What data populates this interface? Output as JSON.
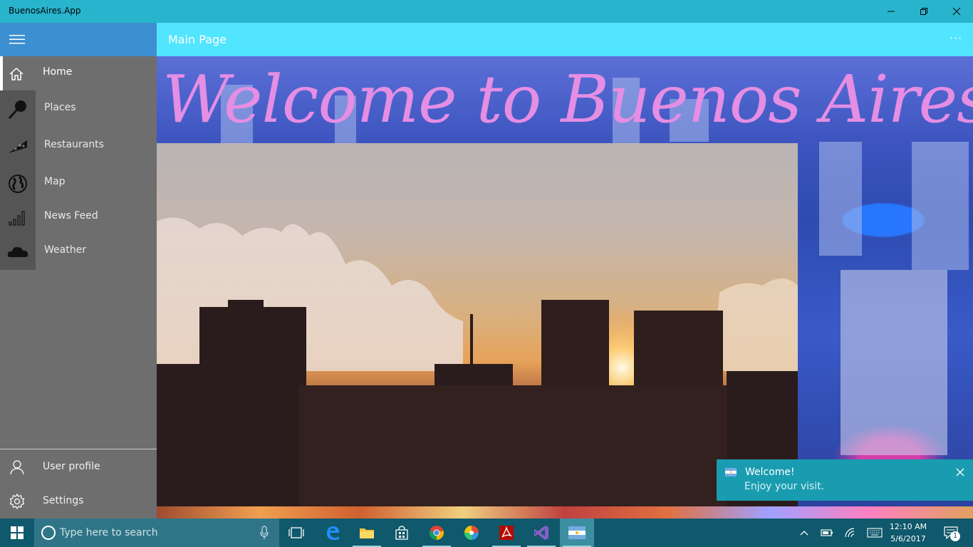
{
  "window": {
    "title": "BuenosAires.App",
    "title_bar_color": "#28b4cc"
  },
  "sidebar": {
    "header_color": "#3c8fd0",
    "items": [
      {
        "label": "Home",
        "icon": "home-icon",
        "active": true
      },
      {
        "label": "Places",
        "icon": "map-pin-icon"
      },
      {
        "label": "Restaurants",
        "icon": "pizza-icon"
      },
      {
        "label": "Map",
        "icon": "globe-icon"
      },
      {
        "label": "News Feed",
        "icon": "signal-bars-icon"
      },
      {
        "label": "Weather",
        "icon": "cloud-icon"
      }
    ],
    "bottom_items": [
      {
        "label": "User profile",
        "icon": "user-icon"
      },
      {
        "label": "Settings",
        "icon": "gear-icon"
      }
    ]
  },
  "page": {
    "title": "Main Page",
    "more_label": "···",
    "header_color": "#52e5ff",
    "welcome_text": "Welcome to Buenos Aires!",
    "welcome_color": "#e48ee4"
  },
  "toast": {
    "title": "Welcome!",
    "body": "Enjoy your visit.",
    "icon": "argentina-flag-icon",
    "color": "#1a9cb0"
  },
  "taskbar": {
    "search_placeholder": "Type here to search",
    "apps": [
      "task-view-icon",
      "edge-icon",
      "file-explorer-icon",
      "store-icon",
      "chrome-icon",
      "color-app-icon",
      "acrobat-icon",
      "visual-studio-icon",
      "buenosaires-app-icon"
    ],
    "time": "12:10 AM",
    "date": "5/6/2017",
    "notification_count": "1"
  }
}
